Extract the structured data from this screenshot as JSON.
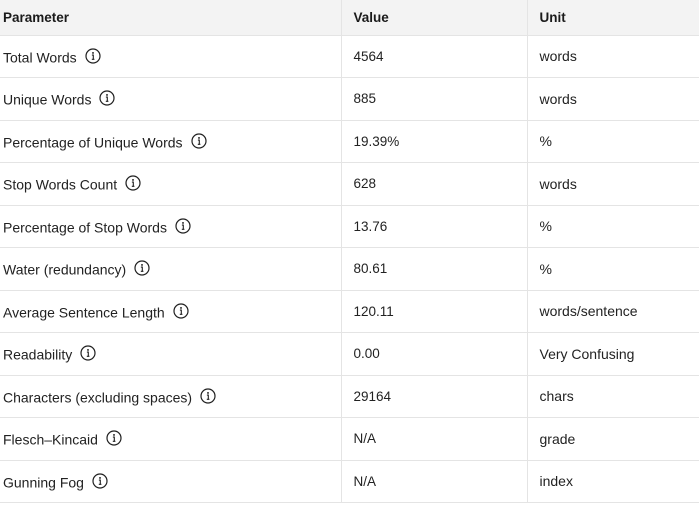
{
  "table": {
    "headers": [
      "Parameter",
      "Value",
      "Unit"
    ],
    "rows": [
      {
        "parameter": "Total Words",
        "value": "4564",
        "unit": "words"
      },
      {
        "parameter": "Unique Words",
        "value": "885",
        "unit": "words"
      },
      {
        "parameter": "Percentage of Unique Words",
        "value": "19.39%",
        "unit": "%"
      },
      {
        "parameter": "Stop Words Count",
        "value": "628",
        "unit": "words"
      },
      {
        "parameter": "Percentage of Stop Words",
        "value": "13.76",
        "unit": "%"
      },
      {
        "parameter": "Water (redundancy)",
        "value": "80.61",
        "unit": "%"
      },
      {
        "parameter": "Average Sentence Length",
        "value": "120.11",
        "unit": "words/sentence"
      },
      {
        "parameter": "Readability",
        "value": "0.00",
        "unit": "Very Confusing"
      },
      {
        "parameter": "Characters (excluding spaces)",
        "value": "29164",
        "unit": "chars"
      },
      {
        "parameter": "Flesch–Kincaid",
        "value": "N/A",
        "unit": "grade"
      },
      {
        "parameter": "Gunning Fog",
        "value": "N/A",
        "unit": "index"
      }
    ]
  },
  "icons": {
    "info": "info-circle-icon"
  },
  "colors": {
    "header_bg": "#f3f3f3",
    "border": "#e4e4e4",
    "text": "#222222"
  }
}
